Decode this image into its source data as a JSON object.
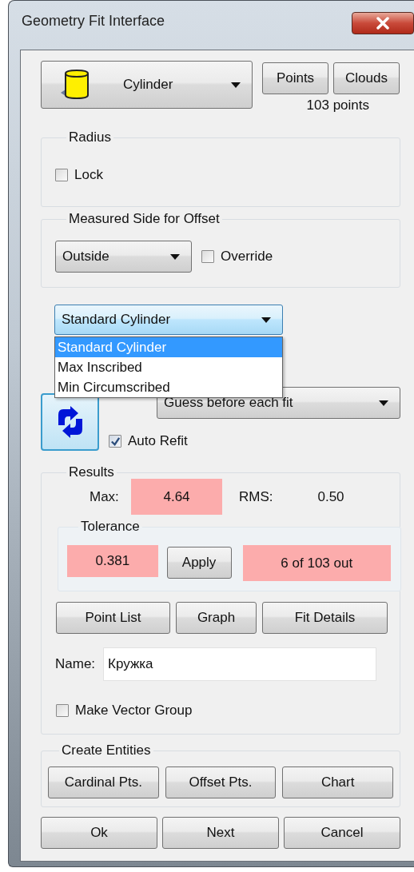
{
  "window": {
    "title": "Geometry Fit Interface"
  },
  "shape_selector": {
    "value": "Cylinder"
  },
  "source_buttons": [
    "Points",
    "Clouds"
  ],
  "point_count": "103 points",
  "radius": {
    "title": "Radius",
    "lock": {
      "label": "Lock",
      "checked": false
    }
  },
  "offset": {
    "title": "Measured Side for Offset",
    "side": "Outside",
    "override": {
      "label": "Override",
      "checked": false
    }
  },
  "fit_type": {
    "value": "Standard Cylinder",
    "expanded": true,
    "options": [
      {
        "label": "Standard Cylinder",
        "selected": true
      },
      {
        "label": "Max Inscribed",
        "selected": false
      },
      {
        "label": "Min Circumscribed",
        "selected": false
      }
    ]
  },
  "guess": {
    "value": "Guess before each fit"
  },
  "auto_refit": {
    "label": "Auto Refit",
    "checked": true
  },
  "results": {
    "title": "Results",
    "max": {
      "label": "Max:",
      "value": "4.64",
      "warning": true
    },
    "rms": {
      "label": "RMS:",
      "value": "0.50",
      "warning": false
    },
    "tolerance": {
      "title": "Tolerance",
      "value": "0.381",
      "warning": true,
      "apply": "Apply",
      "out": "6 of 103 out",
      "out_warning": true
    },
    "buttons": [
      "Point List",
      "Graph",
      "Fit Details"
    ],
    "name": {
      "label": "Name:",
      "value": "Кружка"
    },
    "vector_group": {
      "label": "Make Vector Group",
      "checked": false
    }
  },
  "create_entities": {
    "title": "Create Entities",
    "buttons": [
      "Cardinal Pts.",
      "Offset Pts.",
      "Chart"
    ]
  },
  "footer_buttons": [
    "Ok",
    "Next",
    "Cancel"
  ]
}
